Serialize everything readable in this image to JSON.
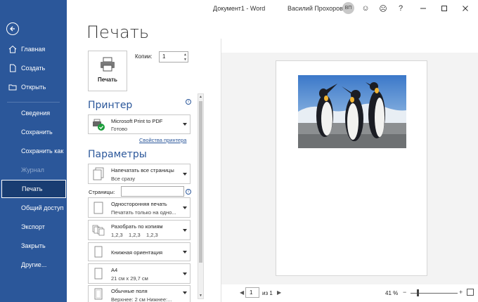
{
  "titlebar": {
    "doc_title": "Документ1 - Word",
    "user_name": "Василий Прохоров",
    "avatar_initials": "ВП",
    "help": "?"
  },
  "sidebar": {
    "items": [
      {
        "label": "Главная",
        "icon": "home-icon"
      },
      {
        "label": "Создать",
        "icon": "new-doc-icon"
      },
      {
        "label": "Открыть",
        "icon": "folder-open-icon"
      },
      {
        "label": "Сведения"
      },
      {
        "label": "Сохранить"
      },
      {
        "label": "Сохранить как"
      },
      {
        "label": "Журнал",
        "disabled": true
      },
      {
        "label": "Печать",
        "active": true
      },
      {
        "label": "Общий доступ"
      },
      {
        "label": "Экспорт"
      },
      {
        "label": "Закрыть"
      },
      {
        "label": "Другие..."
      }
    ]
  },
  "main": {
    "title": "Печать",
    "print_button": "Печать",
    "copies_label": "Копии:",
    "copies_value": "1",
    "printer_heading": "Принтер",
    "printer_name": "Microsoft Print to PDF",
    "printer_status": "Готово",
    "printer_props_link": "Свойства принтера",
    "settings_heading": "Параметры",
    "pages_label": "Страницы:",
    "pages_value": "",
    "settings": [
      {
        "line1": "Напечатать все страницы",
        "line2": "Все сразу"
      },
      {
        "line1": "Односторонняя печать",
        "line2": "Печатать только на одно..."
      },
      {
        "line1": "Разобрать по копиям",
        "line2": "1,2,3    1,2,3    1,2,3"
      },
      {
        "line1": "Книжная ориентация",
        "line2": ""
      },
      {
        "line1": "A4",
        "line2": "21 см x 29,7 см"
      },
      {
        "line1": "Обычные поля",
        "line2": "Верхнее: 2 см Нижнее:..."
      }
    ]
  },
  "preview": {
    "page_current": "1",
    "page_of": "из 1",
    "zoom": "41 %"
  },
  "colors": {
    "sidebar": "#2b579a",
    "accent": "#2b579a"
  }
}
